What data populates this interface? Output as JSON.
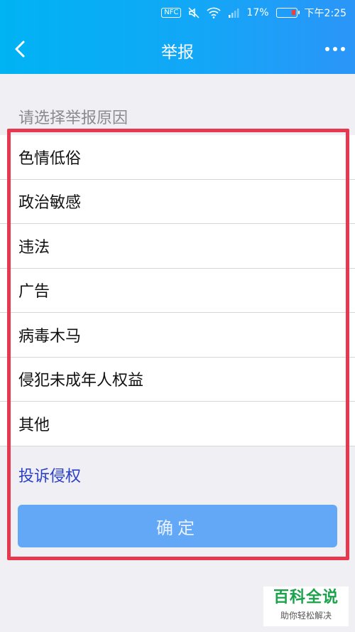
{
  "status_bar": {
    "nfc": "NFC",
    "battery_pct": "17%",
    "time": "下午2:25",
    "icons": [
      "nfc-icon",
      "mute-icon",
      "wifi-icon",
      "signal-icon",
      "battery-icon"
    ]
  },
  "header": {
    "title": "举报",
    "back_icon": "chevron-left-icon",
    "more_icon": "more-dots-icon",
    "background": "#12a7f7"
  },
  "section": {
    "label": "请选择举报原因"
  },
  "reasons": [
    {
      "label": "色情低俗"
    },
    {
      "label": "政治敏感"
    },
    {
      "label": "违法"
    },
    {
      "label": "广告"
    },
    {
      "label": "病毒木马"
    },
    {
      "label": "侵犯未成年人权益"
    },
    {
      "label": "其他"
    }
  ],
  "complaint_link": "投诉侵权",
  "confirm_button": {
    "label": "确定",
    "color": "#62a8f7"
  },
  "highlight_color": "#e8384f",
  "watermark": {
    "title": "百科全说",
    "subtitle": "助你轻松解决"
  }
}
